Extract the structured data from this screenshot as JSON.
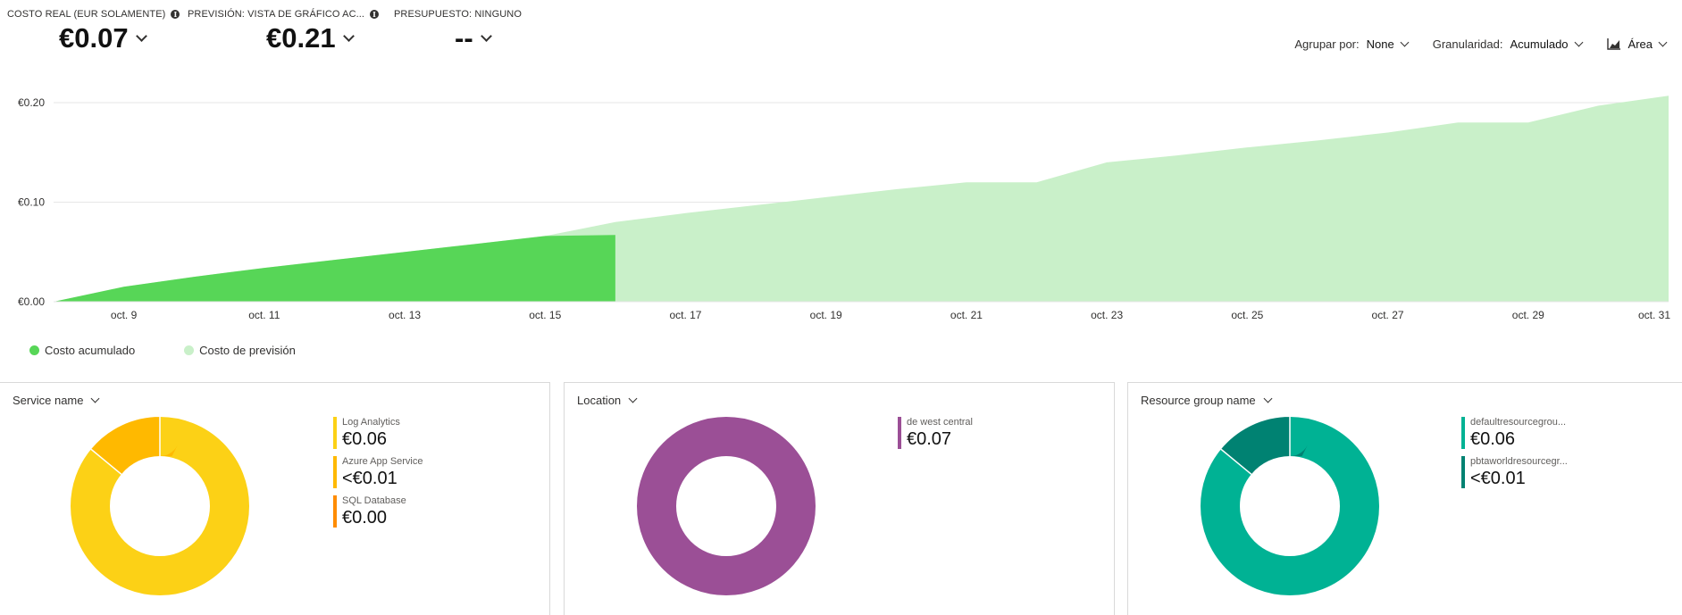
{
  "kpis": [
    {
      "label": "COSTO REAL (EUR SOLAMENTE)",
      "value": "€0.07",
      "has_info": true
    },
    {
      "label": "PREVISIÓN: VISTA DE GRÁFICO AC...",
      "value": "€0.21",
      "has_info": true
    },
    {
      "label": "PRESUPUESTO: NINGUNO",
      "value": "--",
      "has_info": false
    }
  ],
  "controls": {
    "group_label": "Agrupar por:",
    "group_value": "None",
    "granularity_label": "Granularidad:",
    "granularity_value": "Acumulado",
    "view_value": "Área",
    "view_icon": "area-chart-icon"
  },
  "chart_data": {
    "type": "area",
    "y_ticks": [
      "€0.00",
      "€0.10",
      "€0.20"
    ],
    "ylim": [
      0,
      0.2
    ],
    "x_tick_labels": [
      "oct. 9",
      "oct. 11",
      "oct. 13",
      "oct. 15",
      "oct. 17",
      "oct. 19",
      "oct. 21",
      "oct. 23",
      "oct. 25",
      "oct. 27",
      "oct. 29",
      "oct. 31"
    ],
    "x_tick_days": [
      9,
      11,
      13,
      15,
      17,
      19,
      21,
      23,
      25,
      27,
      29,
      31
    ],
    "xlim": [
      8,
      31
    ],
    "grid": true,
    "legend_position": "bottom-left",
    "series": [
      {
        "name": "Costo acumulado",
        "color": "#57d657",
        "x": [
          8,
          9,
          10,
          11,
          12,
          13,
          14,
          15,
          16
        ],
        "y": [
          0.0,
          0.015,
          0.025,
          0.034,
          0.042,
          0.05,
          0.058,
          0.066,
          0.067
        ]
      },
      {
        "name": "Costo de previsión",
        "color": "#c9f0c9",
        "x": [
          16,
          17,
          18,
          19,
          20,
          21,
          22,
          23,
          24,
          25,
          26,
          27,
          28,
          29,
          30,
          31
        ],
        "y": [
          0.08,
          0.089,
          0.097,
          0.105,
          0.113,
          0.12,
          0.12,
          0.14,
          0.147,
          0.155,
          0.162,
          0.17,
          0.18,
          0.18,
          0.197,
          0.207
        ]
      }
    ]
  },
  "panels": [
    {
      "title": "Service name",
      "items": [
        {
          "name": "Log Analytics",
          "value": "€0.06",
          "color": "#fcd116",
          "share": 0.86
        },
        {
          "name": "Azure App Service",
          "value": "<€0.01",
          "color": "#ffb900",
          "share": 0.14
        },
        {
          "name": "SQL Database",
          "value": "€0.00",
          "color": "#ff8c00",
          "share": 0.0
        }
      ]
    },
    {
      "title": "Location",
      "items": [
        {
          "name": "de west central",
          "value": "€0.07",
          "color": "#9b4f96",
          "share": 1.0
        }
      ]
    },
    {
      "title": "Resource group name",
      "items": [
        {
          "name": "defaultresourcegrou...",
          "value": "€0.06",
          "color": "#00b294",
          "share": 0.86
        },
        {
          "name": "pbtaworldresourcegr...",
          "value": "<€0.01",
          "color": "#008272",
          "share": 0.14
        }
      ]
    }
  ]
}
